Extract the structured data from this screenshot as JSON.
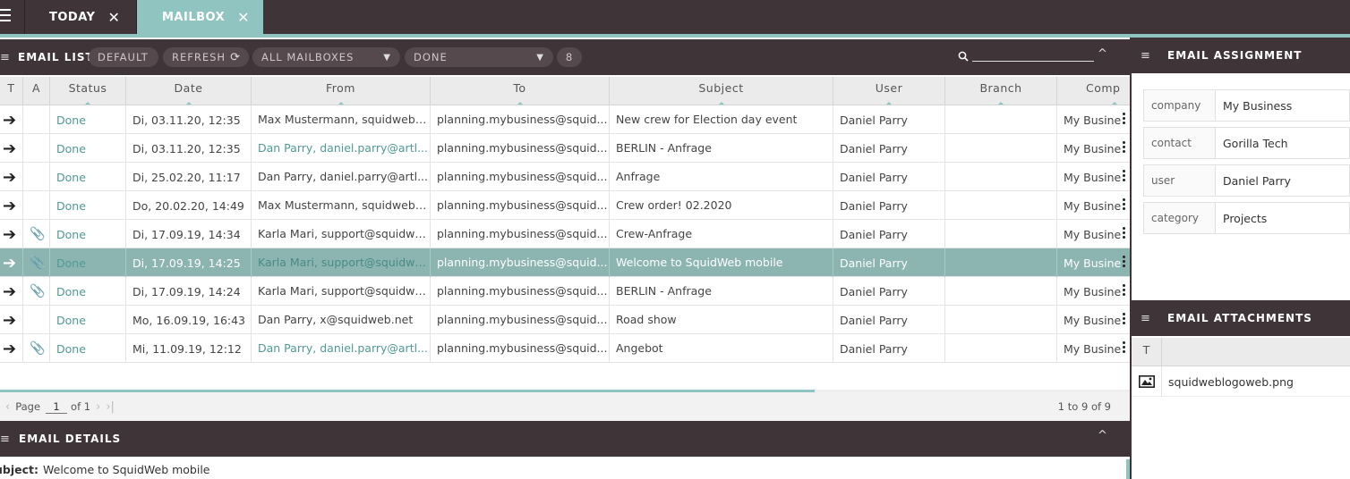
{
  "tabs": [
    {
      "label": "TODAY",
      "active": false
    },
    {
      "label": "MAILBOX",
      "active": true
    }
  ],
  "toolbar": {
    "title": "EMAIL LIST",
    "default_label": "DEFAULT",
    "refresh_label": "REFRESH",
    "mailbox_select": "ALL MAILBOXES",
    "status_select": "DONE",
    "count_badge": "8",
    "search_placeholder": ""
  },
  "grid": {
    "columns": [
      "T",
      "A",
      "Status",
      "Date",
      "From",
      "To",
      "Subject",
      "User",
      "Branch",
      "Comp"
    ],
    "rows": [
      {
        "status": "Done",
        "date": "Di, 03.11.20, 12:35",
        "from": "Max Mustermann, squidwebu...",
        "from_teal": false,
        "to": "planning.mybusiness@squid...",
        "subject": "New crew for Election day event",
        "user": "Daniel Parry",
        "branch": "",
        "company": "My Busine",
        "attachment": false,
        "selected": false
      },
      {
        "status": "Done",
        "date": "Di, 03.11.20, 12:35",
        "from": "Dan Parry, daniel.parry@artl...",
        "from_teal": true,
        "to": "planning.mybusiness@squid...",
        "subject": "BERLIN - Anfrage",
        "user": "Daniel Parry",
        "branch": "",
        "company": "My Busine",
        "attachment": false,
        "selected": false
      },
      {
        "status": "Done",
        "date": "Di, 25.02.20, 11:17",
        "from": "Dan Parry, daniel.parry@artl...",
        "from_teal": false,
        "to": "planning.mybusiness@squid...",
        "subject": "Anfrage",
        "user": "Daniel Parry",
        "branch": "",
        "company": "My Busine",
        "attachment": false,
        "selected": false
      },
      {
        "status": "Done",
        "date": "Do, 20.02.20, 14:49",
        "from": "Max Mustermann, squidwebu...",
        "from_teal": false,
        "to": "planning.mybusiness@squid...",
        "subject": "Crew order! 02.2020",
        "user": "Daniel Parry",
        "branch": "",
        "company": "My Busine",
        "attachment": false,
        "selected": false
      },
      {
        "status": "Done",
        "date": "Di, 17.09.19, 14:34",
        "from": "Karla Mari, support@squidwe...",
        "from_teal": false,
        "to": "planning.mybusiness@squid...",
        "subject": "Crew-Anfrage",
        "user": "Daniel Parry",
        "branch": "",
        "company": "My Busine",
        "attachment": true,
        "selected": false
      },
      {
        "status": "Done",
        "date": "Di, 17.09.19, 14:25",
        "from": "Karla Mari, support@squidwe...",
        "from_teal": false,
        "to": "planning.mybusiness@squid...",
        "subject": "Welcome to SquidWeb mobile",
        "user": "Daniel Parry",
        "branch": "",
        "company": "My Busine",
        "attachment": true,
        "selected": true
      },
      {
        "status": "Done",
        "date": "Di, 17.09.19, 14:24",
        "from": "Karla Mari, support@squidwe...",
        "from_teal": false,
        "to": "planning.mybusiness@squid...",
        "subject": "BERLIN - Anfrage",
        "user": "Daniel Parry",
        "branch": "",
        "company": "My Busine",
        "attachment": true,
        "selected": false
      },
      {
        "status": "Done",
        "date": "Mo, 16.09.19, 16:43",
        "from": "Dan Parry, x@squidweb.net",
        "from_teal": false,
        "to": "planning.mybusiness@squid...",
        "subject": "Road show",
        "user": "Daniel Parry",
        "branch": "",
        "company": "My Busine",
        "attachment": false,
        "selected": false
      },
      {
        "status": "Done",
        "date": "Mi, 11.09.19, 12:12",
        "from": "Dan Parry, daniel.parry@artl...",
        "from_teal": true,
        "to": "planning.mybusiness@squid...",
        "subject": "Angebot",
        "user": "Daniel Parry",
        "branch": "",
        "company": "My Busine",
        "attachment": true,
        "selected": false
      }
    ]
  },
  "pager": {
    "page_label": "Page",
    "page_value": "1",
    "of_label": "of 1",
    "info": "1 to 9 of 9"
  },
  "details": {
    "title": "EMAIL DETAILS",
    "subject_label": "ubject:",
    "subject_value": "Welcome to SquidWeb mobile"
  },
  "assignment": {
    "title": "EMAIL ASSIGNMENT",
    "fields": [
      {
        "key": "company",
        "value": "My Business"
      },
      {
        "key": "contact",
        "value": "Gorilla Tech"
      },
      {
        "key": "user",
        "value": "Daniel Parry"
      },
      {
        "key": "category",
        "value": "Projects"
      }
    ]
  },
  "attachments": {
    "title": "EMAIL ATTACHMENTS",
    "column": "T",
    "files": [
      {
        "name": "squidweblogoweb.png",
        "icon": "image-icon"
      }
    ]
  },
  "colors": {
    "dark_bar": "#3f3438",
    "accent": "#8fc4c0",
    "selected_row": "#8cb5b2",
    "status_text": "#4f9a94"
  }
}
